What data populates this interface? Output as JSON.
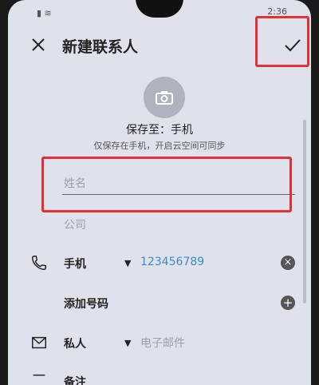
{
  "status": {
    "left_icons": "▮ ≋",
    "time": "2:36"
  },
  "header": {
    "title": "新建联系人"
  },
  "save_location": {
    "title": "保存至：手机",
    "note": "仅保存在手机，开启云空间可同步"
  },
  "fields": {
    "name_placeholder": "姓名",
    "company_placeholder": "公司"
  },
  "phone_row": {
    "label": "手机",
    "value": "123456789"
  },
  "add_number": {
    "label": "添加号码"
  },
  "email_row": {
    "label": "私人",
    "placeholder": "电子邮件"
  },
  "note_row": {
    "label": "备注"
  },
  "colors": {
    "accent": "#3b8bd2",
    "highlight": "#e53030",
    "background": "#dfe2ec"
  }
}
